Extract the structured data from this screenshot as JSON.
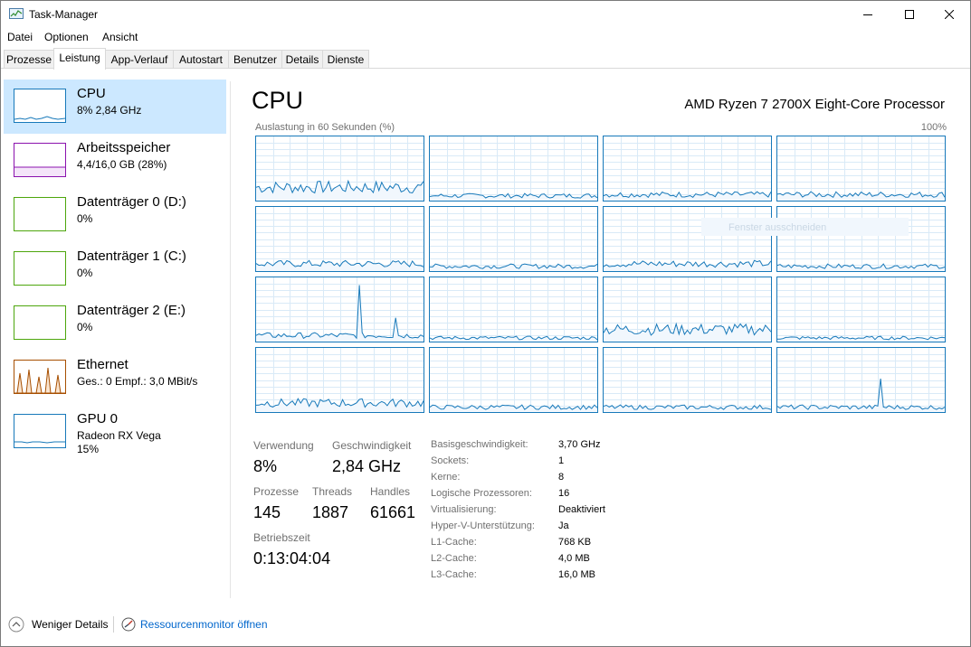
{
  "window": {
    "title": "Task-Manager"
  },
  "menu": [
    "Datei",
    "Optionen",
    "Ansicht"
  ],
  "tabs": [
    "Prozesse",
    "Leistung",
    "App-Verlauf",
    "Autostart",
    "Benutzer",
    "Details",
    "Dienste"
  ],
  "active_tab": "Leistung",
  "sidebar": {
    "items": [
      {
        "title": "CPU",
        "sub": "8%  2,84 GHz",
        "color": "#1779ba"
      },
      {
        "title": "Arbeitsspeicher",
        "sub": "4,4/16,0 GB (28%)",
        "color": "#8b12ae"
      },
      {
        "title": "Datenträger 0 (D:)",
        "sub": "0%",
        "color": "#4da60c"
      },
      {
        "title": "Datenträger 1 (C:)",
        "sub": "0%",
        "color": "#4da60c"
      },
      {
        "title": "Datenträger 2 (E:)",
        "sub": "0%",
        "color": "#4da60c"
      },
      {
        "title": "Ethernet",
        "sub": "Ges.: 0  Empf.: 3,0 MBit/s",
        "color": "#a74f01"
      },
      {
        "title": "GPU 0",
        "sub": "Radeon RX Vega",
        "sub2": "15%",
        "color": "#1779ba"
      }
    ]
  },
  "main": {
    "title": "CPU",
    "model": "AMD Ryzen 7 2700X Eight-Core Processor",
    "graph_caption": "Auslastung in 60 Sekunden (%)",
    "graph_max": "100%",
    "ghost_tooltip": "Fenster ausschneiden",
    "logical_processor_graphs": 16
  },
  "stats": {
    "usage_label": "Verwendung",
    "usage_value": "8%",
    "speed_label": "Geschwindigkeit",
    "speed_value": "2,84 GHz",
    "processes_label": "Prozesse",
    "processes_value": "145",
    "threads_label": "Threads",
    "threads_value": "1887",
    "handles_label": "Handles",
    "handles_value": "61661",
    "uptime_label": "Betriebszeit",
    "uptime_value": "0:13:04:04"
  },
  "details": [
    {
      "label": "Basisgeschwindigkeit:",
      "value": "3,70 GHz"
    },
    {
      "label": "Sockets:",
      "value": "1"
    },
    {
      "label": "Kerne:",
      "value": "8"
    },
    {
      "label": "Logische Prozessoren:",
      "value": "16"
    },
    {
      "label": "Virtualisierung:",
      "value": "Deaktiviert"
    },
    {
      "label": "Hyper-V-Unterstützung:",
      "value": "Ja"
    },
    {
      "label": "L1-Cache:",
      "value": "768 KB"
    },
    {
      "label": "L2-Cache:",
      "value": "4,0 MB"
    },
    {
      "label": "L3-Cache:",
      "value": "16,0 MB"
    }
  ],
  "footer": {
    "fewer_details": "Weniger Details",
    "resource_monitor": "Ressourcenmonitor öffnen"
  },
  "colors": {
    "cpu": "#1779ba",
    "memory": "#8b12ae",
    "disk": "#4da60c",
    "ethernet": "#a74f01",
    "selected_bg": "#cce8ff",
    "link": "#0066cc"
  }
}
